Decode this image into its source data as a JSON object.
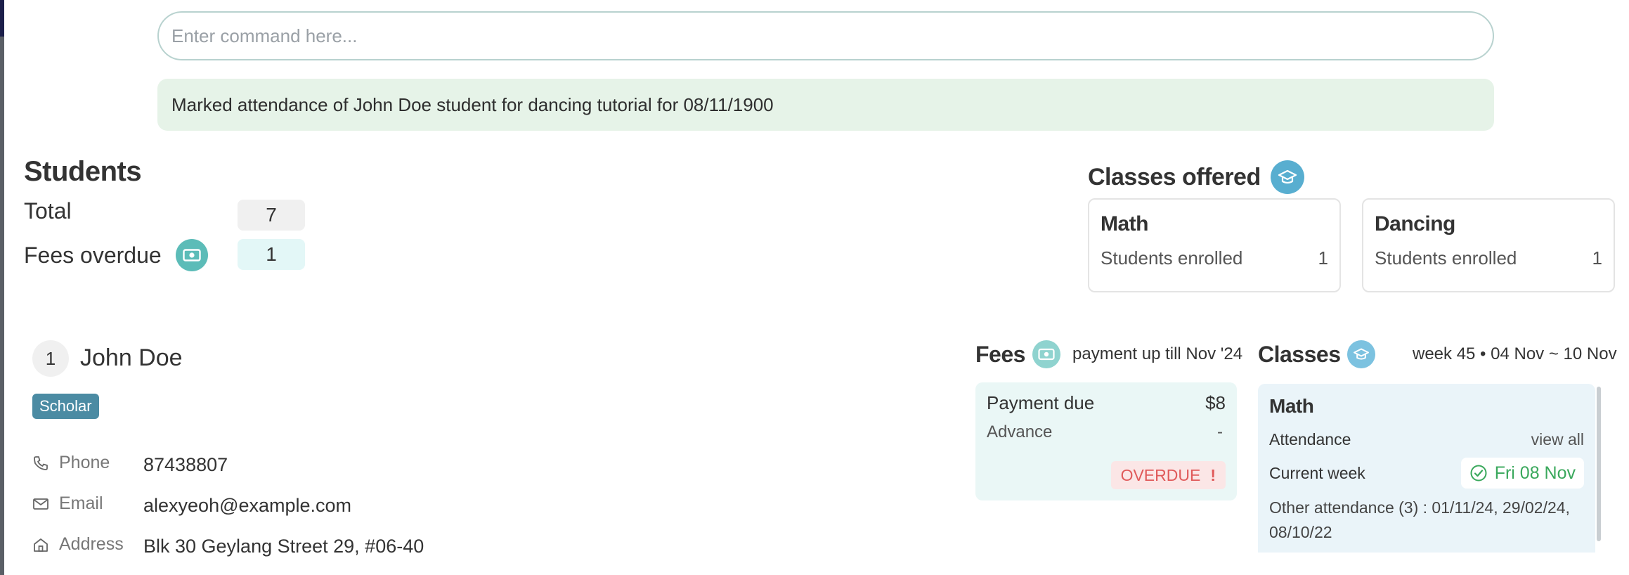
{
  "command": {
    "placeholder": "Enter command here..."
  },
  "result": {
    "message": "Marked attendance of John Doe student for dancing tutorial for 08/11/1900"
  },
  "students": {
    "title": "Students",
    "total_label": "Total",
    "total_value": "7",
    "overdue_label": "Fees overdue",
    "overdue_value": "1"
  },
  "classes_offered": {
    "title": "Classes offered",
    "items": [
      {
        "name": "Math",
        "label": "Students enrolled",
        "count": "1"
      },
      {
        "name": "Dancing",
        "label": "Students enrolled",
        "count": "1"
      }
    ]
  },
  "student": {
    "index": "1",
    "name": "John Doe",
    "tag": "Scholar",
    "phone_label": "Phone",
    "phone": "87438807",
    "email_label": "Email",
    "email": "alexyeoh@example.com",
    "address_label": "Address",
    "address": "Blk 30 Geylang Street 29, #06-40"
  },
  "fees": {
    "title": "Fees",
    "subtitle": "payment up till Nov '24",
    "payment_due_label": "Payment due",
    "payment_due_value": "$8",
    "advance_label": "Advance",
    "advance_value": "-",
    "status": "OVERDUE",
    "status_mark": "!"
  },
  "classes": {
    "title": "Classes",
    "subtitle": "week 45 • 04 Nov ~ 10 Nov",
    "class_name": "Math",
    "attendance_label": "Attendance",
    "view_all": "view all",
    "current_week_label": "Current week",
    "current_week_value": "Fri 08 Nov",
    "other_attendance": "Other attendance (3) : 01/11/24, 29/02/24, 08/10/22"
  },
  "colors": {
    "accent_teal": "#5cbcb8",
    "accent_blue": "#58aed0",
    "success_bg": "#e6f3e8",
    "danger": "#e05a5a",
    "success": "#3aa85c",
    "tag_bg": "#4b8ba3"
  },
  "icons": [
    "money-icon",
    "graduation-cap-icon",
    "phone-icon",
    "mail-icon",
    "home-icon",
    "check-circle-icon"
  ]
}
